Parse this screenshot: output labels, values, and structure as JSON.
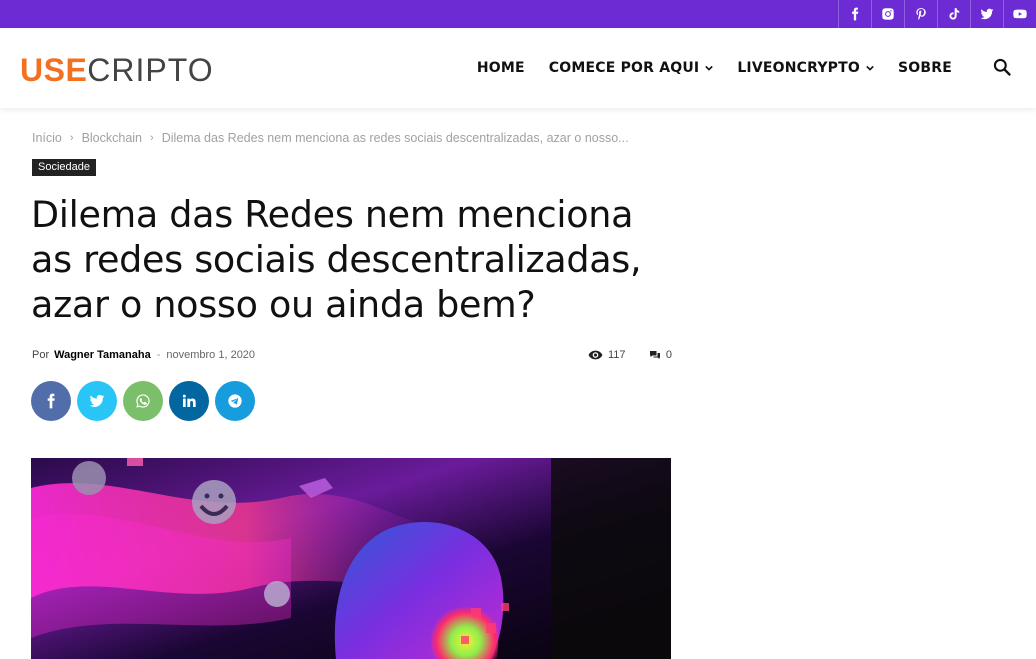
{
  "social_top": [
    {
      "name": "facebook",
      "icon": "facebook-icon"
    },
    {
      "name": "instagram",
      "icon": "instagram-icon"
    },
    {
      "name": "pinterest",
      "icon": "pinterest-icon"
    },
    {
      "name": "tiktok",
      "icon": "tiktok-icon"
    },
    {
      "name": "twitter",
      "icon": "twitter-icon"
    },
    {
      "name": "youtube",
      "icon": "youtube-icon"
    }
  ],
  "logo": {
    "part1": "USE",
    "part2": "CRIPTO"
  },
  "nav": {
    "home": "HOME",
    "start": "COMECE POR AQUI",
    "live": "LIVEONCRYPTO",
    "about": "SOBRE"
  },
  "breadcrumb": {
    "home": "Início",
    "category": "Blockchain",
    "current": "Dilema das Redes nem menciona as redes sociais descentralizadas, azar o nosso..."
  },
  "category_badge": "Sociedade",
  "article": {
    "title": "Dilema das Redes nem menciona as redes sociais descentralizadas, azar o nosso ou ainda bem?",
    "by": "Por",
    "author": "Wagner Tamanaha",
    "dash": "-",
    "date": "novembro 1, 2020",
    "views": "117",
    "comments": "0"
  },
  "share_buttons": [
    "facebook",
    "twitter",
    "whatsapp",
    "linkedin",
    "telegram"
  ],
  "colors": {
    "topbar": "#6c2bd3",
    "logo_accent": "#f37021",
    "facebook": "#516eab",
    "twitter": "#29c5f6",
    "whatsapp": "#7bbf6a",
    "linkedin": "#0266a0",
    "telegram": "#179cde"
  }
}
